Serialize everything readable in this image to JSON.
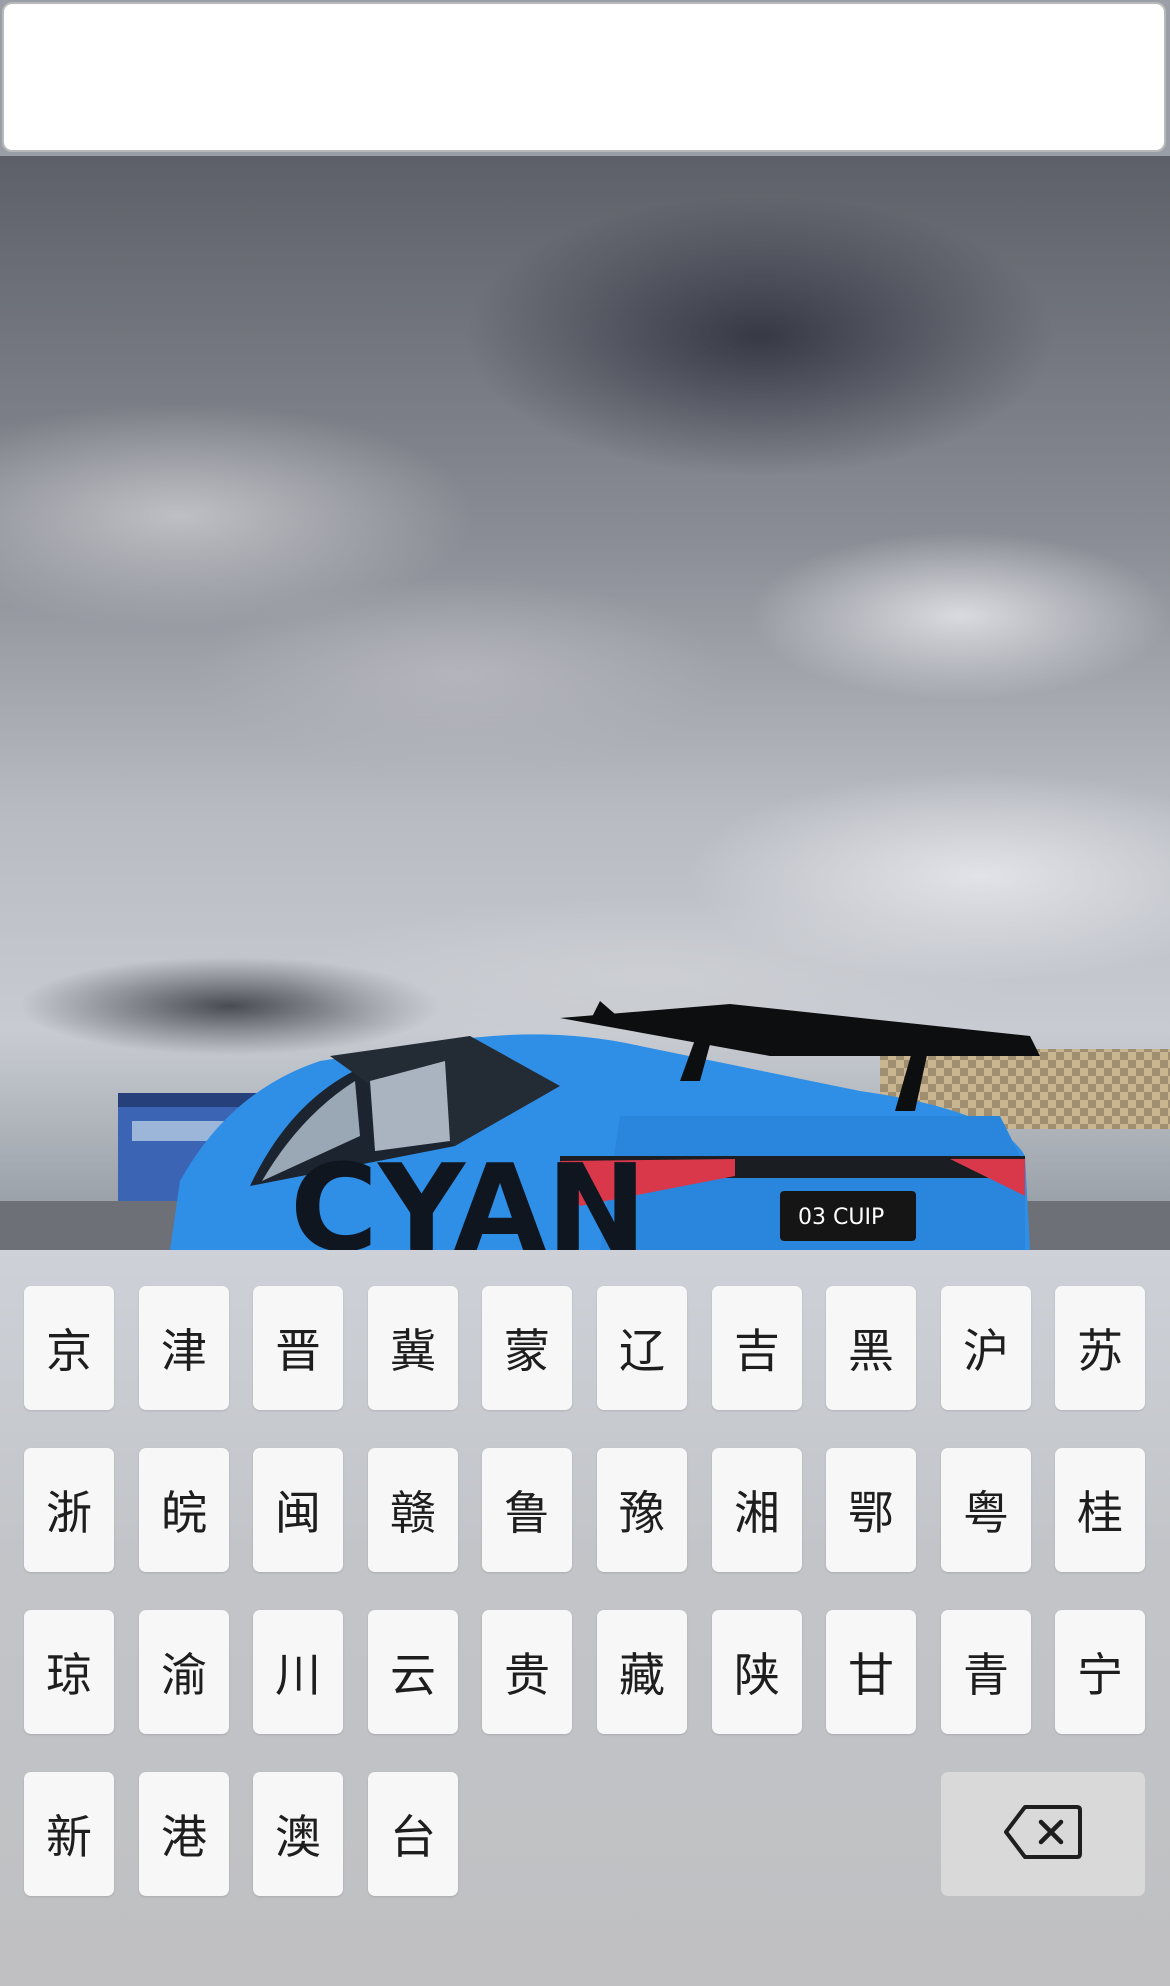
{
  "input": {
    "value": "",
    "placeholder": ""
  },
  "keyboard": {
    "rows": [
      [
        "京",
        "津",
        "晋",
        "冀",
        "蒙",
        "辽",
        "吉",
        "黑",
        "沪",
        "苏"
      ],
      [
        "浙",
        "皖",
        "闽",
        "赣",
        "鲁",
        "豫",
        "湘",
        "鄂",
        "粤",
        "桂"
      ],
      [
        "琼",
        "渝",
        "川",
        "云",
        "贵",
        "藏",
        "陕",
        "甘",
        "青",
        "宁"
      ],
      [
        "新",
        "港",
        "澳",
        "台"
      ]
    ],
    "backspace_icon": "backspace-icon"
  },
  "photo": {
    "car_plate": "03 CUIP",
    "car_livery": "CYAN",
    "car_color": "#2f8fe6"
  }
}
